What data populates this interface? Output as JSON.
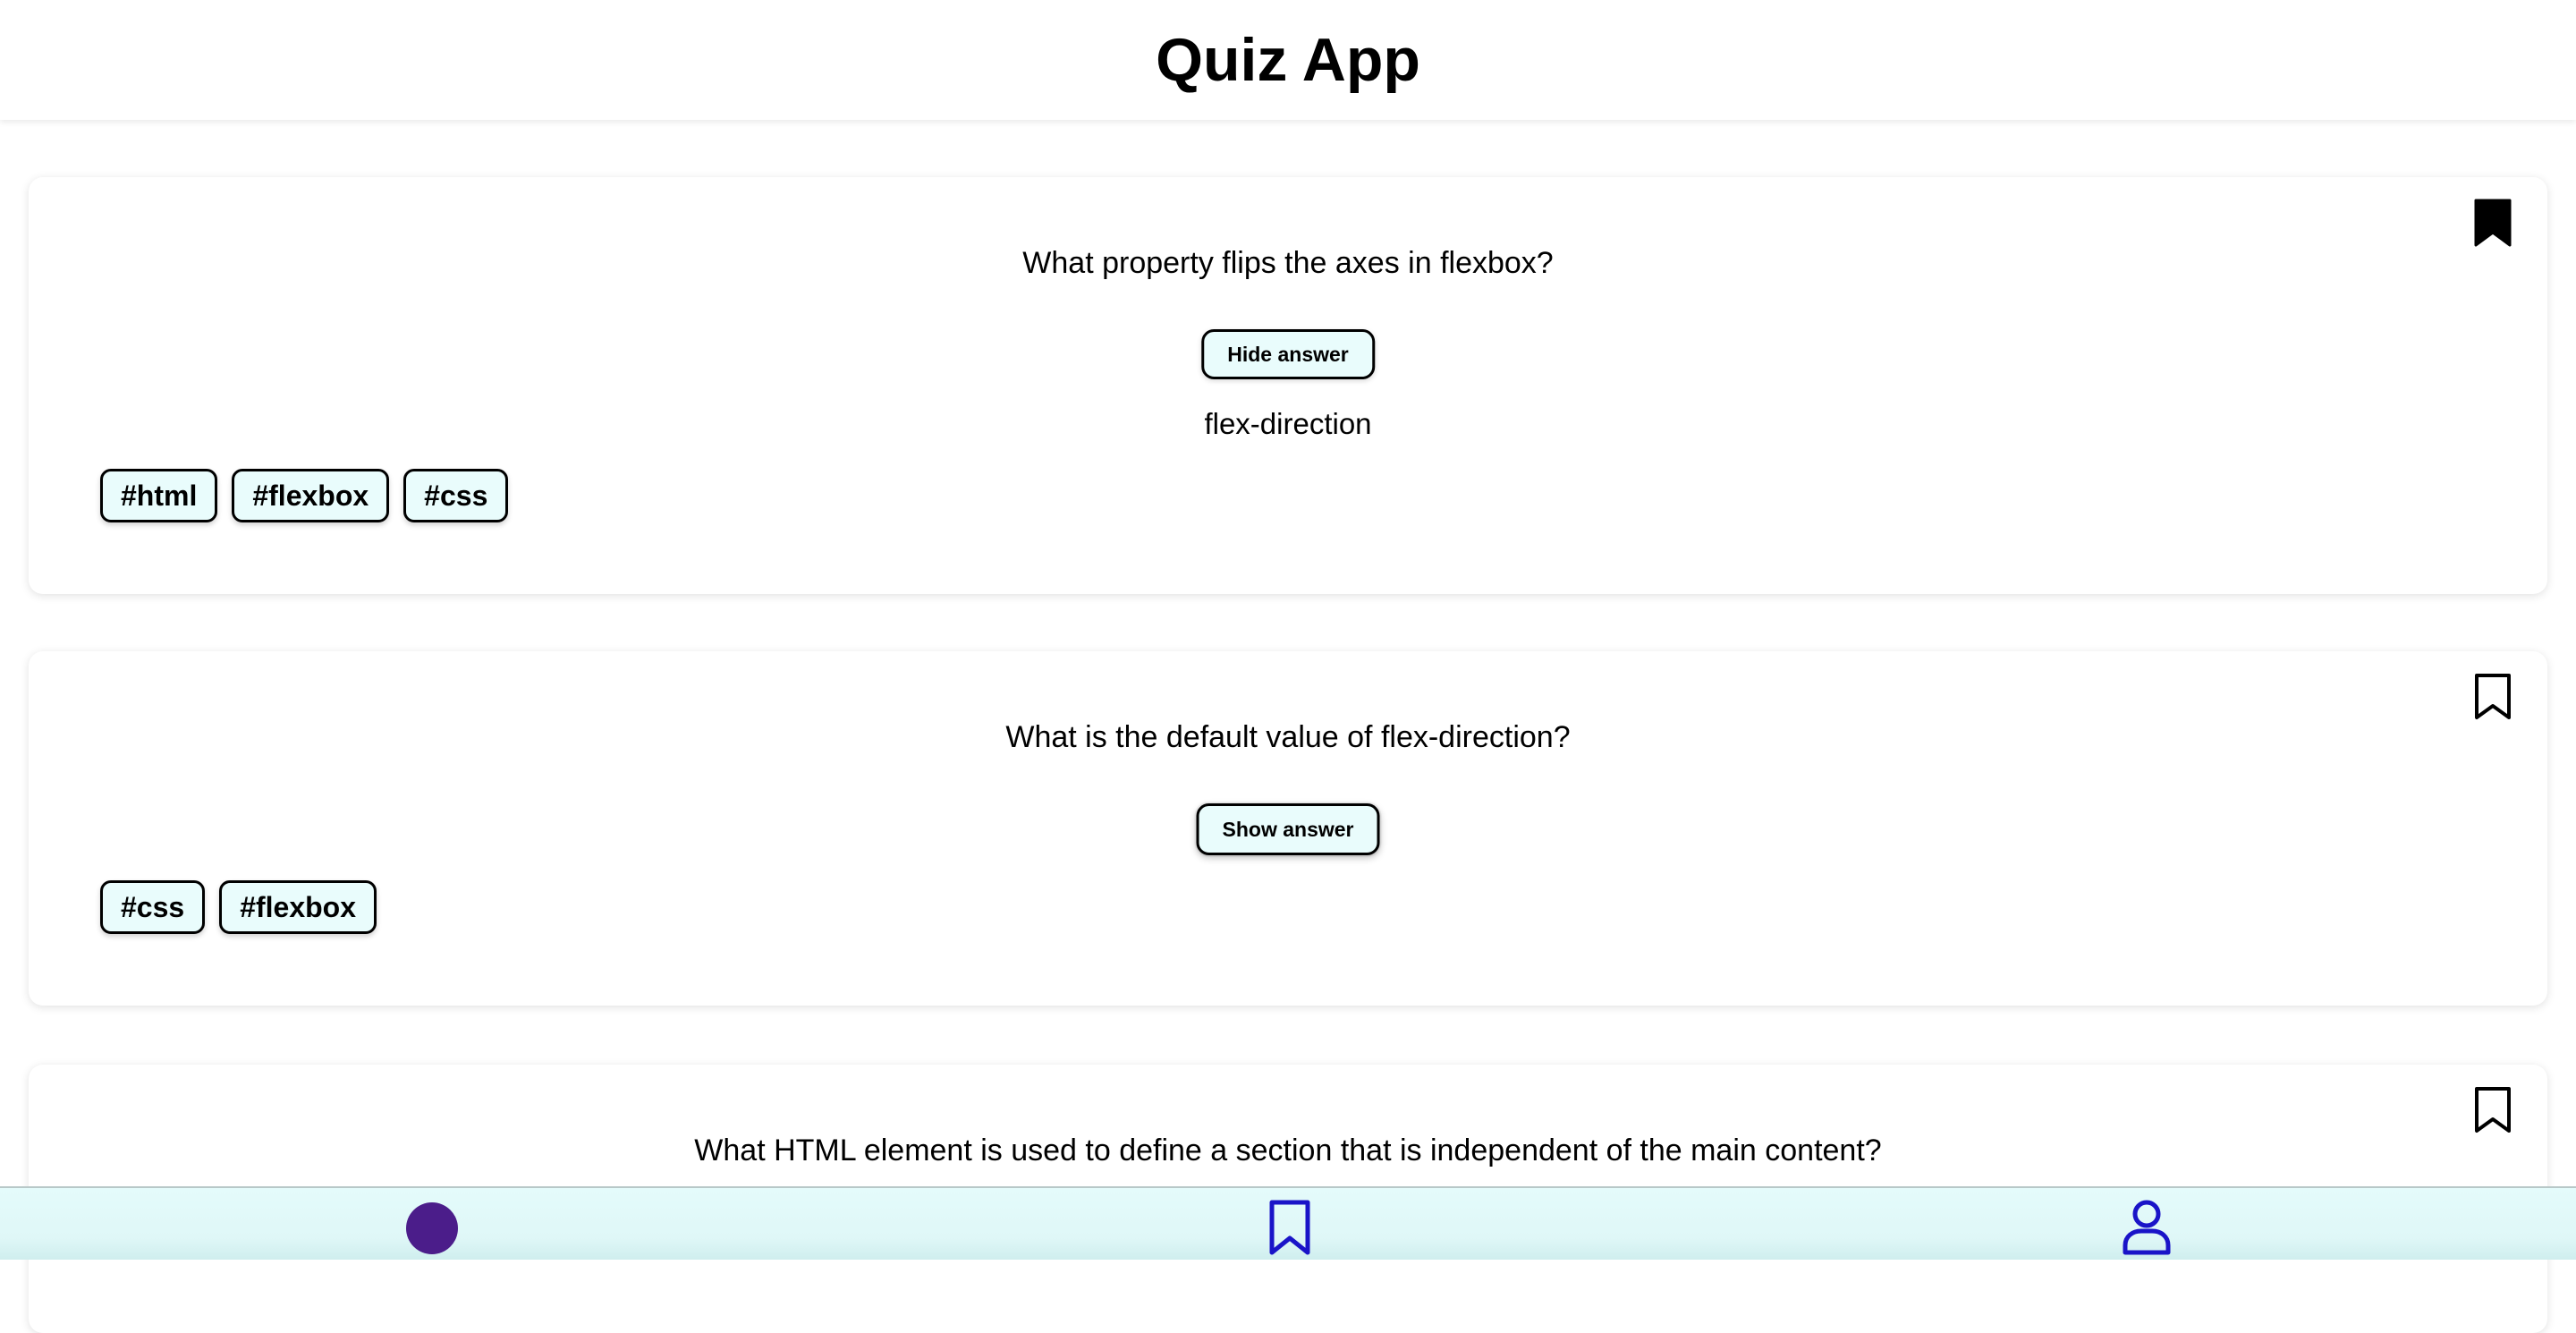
{
  "header": {
    "title": "Quiz App"
  },
  "cards": [
    {
      "question": "What property flips the axes in flexbox?",
      "button_label": "Hide answer",
      "answer": "flex-direction",
      "bookmarked": true,
      "tags": [
        "#html",
        "#flexbox",
        "#css"
      ]
    },
    {
      "question": "What is the default value of flex-direction?",
      "button_label": "Show answer",
      "bookmarked": false,
      "tags": [
        "#css",
        "#flexbox"
      ]
    },
    {
      "question": "What HTML element is used to define a section that is independent of the main content?",
      "bookmarked": false
    }
  ],
  "bottom_nav": {
    "items": [
      {
        "icon": "home-dot-icon",
        "color": "#4b1d8a"
      },
      {
        "icon": "bookmark-icon",
        "color": "#1a14c8"
      },
      {
        "icon": "profile-icon",
        "color": "#1a14c8"
      }
    ]
  },
  "colors": {
    "button_bg": "#e9fcfc",
    "nav_bg": "#e4fbfb",
    "nav_icon": "#1a14c8",
    "home_dot": "#4b1d8a"
  }
}
